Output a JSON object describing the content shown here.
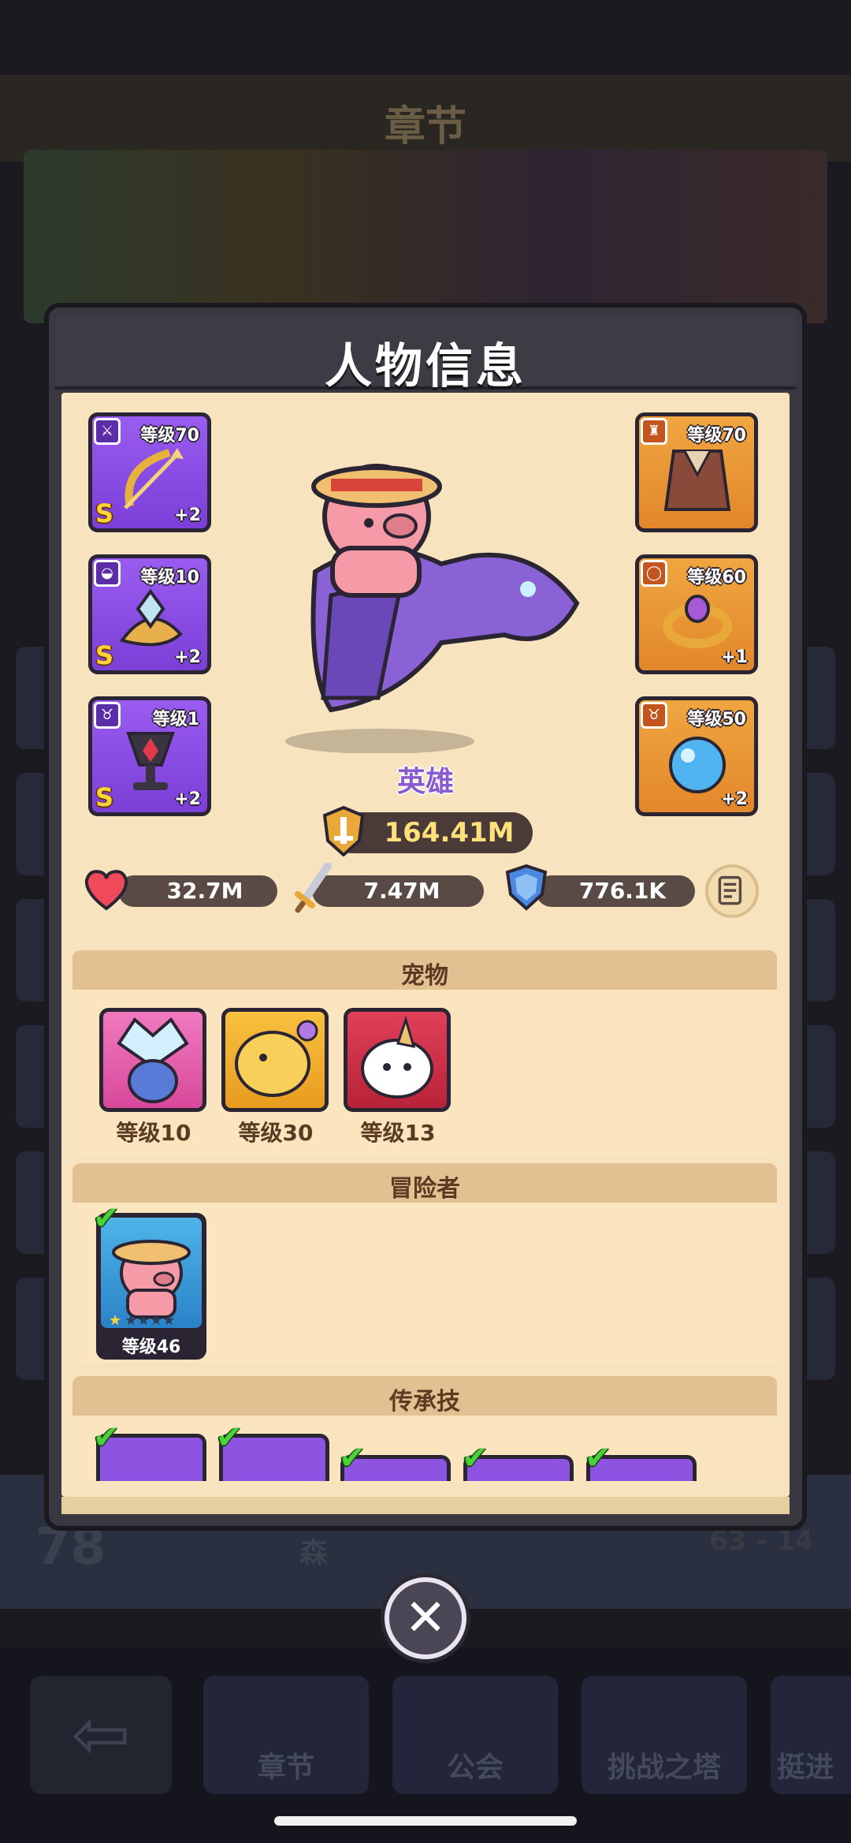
{
  "background": {
    "title": "章节",
    "rank": "78",
    "name": "森",
    "score": "63 - 14",
    "nav": [
      "章节",
      "公会",
      "挑战之塔",
      "挺进"
    ]
  },
  "modal": {
    "title": "人物信息",
    "left_equipment": [
      {
        "level": "等级70",
        "grade": "S",
        "plus": "+2",
        "icon": "sword-icon",
        "item": "bow-and-arrow"
      },
      {
        "level": "等级10",
        "grade": "S",
        "plus": "+2",
        "icon": "helmet-icon",
        "item": "crystal-helm"
      },
      {
        "level": "等级1",
        "grade": "S",
        "plus": "+2",
        "icon": "amulet-icon",
        "item": "chalice"
      }
    ],
    "right_equipment": [
      {
        "level": "等级70",
        "plus": "",
        "icon": "armor-icon",
        "item": "fur-cloak"
      },
      {
        "level": "等级60",
        "plus": "+1",
        "icon": "ring-icon",
        "item": "gem-ring"
      },
      {
        "level": "等级50",
        "plus": "+2",
        "icon": "necklace-icon",
        "item": "blue-orb"
      }
    ],
    "hero_label": "英雄",
    "power": "164.41M",
    "stats": {
      "hp": "32.7M",
      "attack": "7.47M",
      "defense": "776.1K"
    },
    "sections": {
      "pets_title": "宠物",
      "adventurer_title": "冒险者",
      "legacy_title": "传承技"
    },
    "pets": [
      {
        "level": "等级10",
        "color": "#e85aa8"
      },
      {
        "level": "等级30",
        "color": "#f2b030"
      },
      {
        "level": "等级13",
        "color": "#d8324a"
      }
    ],
    "adventurer": {
      "level": "等级46"
    }
  }
}
